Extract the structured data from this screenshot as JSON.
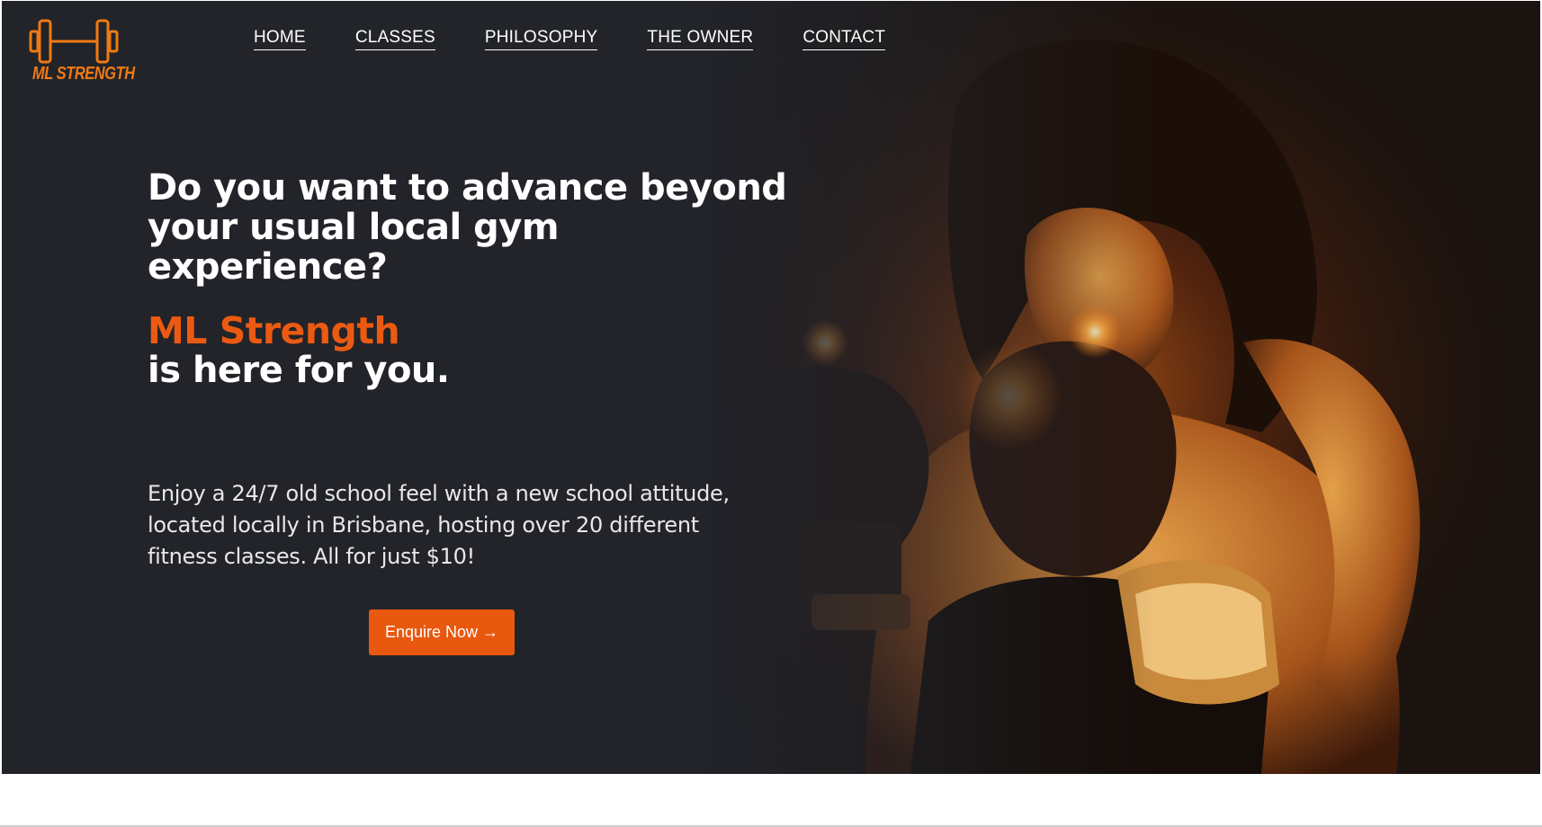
{
  "brand": {
    "logo_text": "ML STRENGTH",
    "logo_icon": "dumbbell-icon",
    "accent_color": "#ec5a12"
  },
  "nav": {
    "items": [
      {
        "label": "HOME"
      },
      {
        "label": "CLASSES"
      },
      {
        "label": "PHILOSOPHY"
      },
      {
        "label": "THE OWNER"
      },
      {
        "label": "CONTACT"
      }
    ]
  },
  "hero": {
    "headline": "Do you want to advance beyond your usual local gym experience?",
    "brand_line": "ML Strength",
    "tagline": "is here for you.",
    "body": "Enjoy a 24/7 old school feel with a new school attitude, located locally in Brisbane, hosting over 20 different fitness classes. All for just $10!",
    "cta_label": "Enquire Now →",
    "background_color": "#22242a",
    "cta_color": "#e8580f"
  }
}
